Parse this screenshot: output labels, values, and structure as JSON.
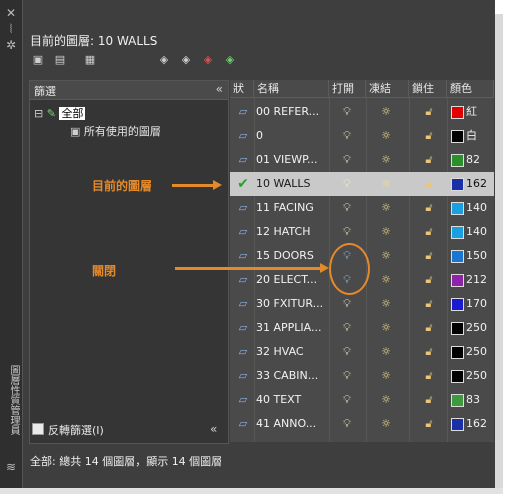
{
  "title": "目前的圖層: 10 WALLS",
  "filter_pane": {
    "header": "篩選",
    "tree": [
      {
        "label": "全部",
        "selected": true
      },
      {
        "label": "所有使用的圖層",
        "selected": false
      }
    ],
    "invert_label": "反轉篩選(I)"
  },
  "side_strip_label": "圖層性質管理員",
  "columns": [
    "狀",
    "名稱",
    "打開",
    "凍結",
    "鎖住",
    "顏色"
  ],
  "layers": [
    {
      "name": "00 REFER...",
      "on": true,
      "color": "#e00000",
      "color_label": "紅"
    },
    {
      "name": "0",
      "on": true,
      "color": "#000000",
      "color_label": "白"
    },
    {
      "name": "01 VIEWP...",
      "on": true,
      "color": "#2b8f2b",
      "color_label": "82"
    },
    {
      "name": "10 WALLS",
      "on": true,
      "color": "#1a2fa8",
      "color_label": "162",
      "current": true
    },
    {
      "name": "11 FACING",
      "on": true,
      "color": "#1aa0e0",
      "color_label": "140"
    },
    {
      "name": "12 HATCH",
      "on": true,
      "color": "#1aa0e0",
      "color_label": "140"
    },
    {
      "name": "15 DOORS",
      "on": false,
      "color": "#1976d2",
      "color_label": "150"
    },
    {
      "name": "20 ELECT...",
      "on": false,
      "color": "#8e24aa",
      "color_label": "212"
    },
    {
      "name": "30 FXITUR...",
      "on": true,
      "color": "#1a1ad0",
      "color_label": "170"
    },
    {
      "name": "31 APPLIA...",
      "on": true,
      "color": "#000000",
      "color_label": "250"
    },
    {
      "name": "32 HVAC",
      "on": true,
      "color": "#000000",
      "color_label": "250"
    },
    {
      "name": "33 CABIN...",
      "on": true,
      "color": "#000000",
      "color_label": "250"
    },
    {
      "name": "40 TEXT",
      "on": true,
      "color": "#3f9a3f",
      "color_label": "83"
    },
    {
      "name": "41 ANNO...",
      "on": true,
      "color": "#1a2fa8",
      "color_label": "162"
    }
  ],
  "status_line": "全部: 總共 14 個圖層，顯示 14 個圖層",
  "callouts": {
    "current_layer": "目前的圖層",
    "off": "關閉"
  },
  "icons": {
    "status": "layer-icon",
    "current": "checkmark-icon",
    "on": "lightbulb-icon",
    "freeze": "sun-icon",
    "lock": "unlocked-padlock-icon"
  }
}
